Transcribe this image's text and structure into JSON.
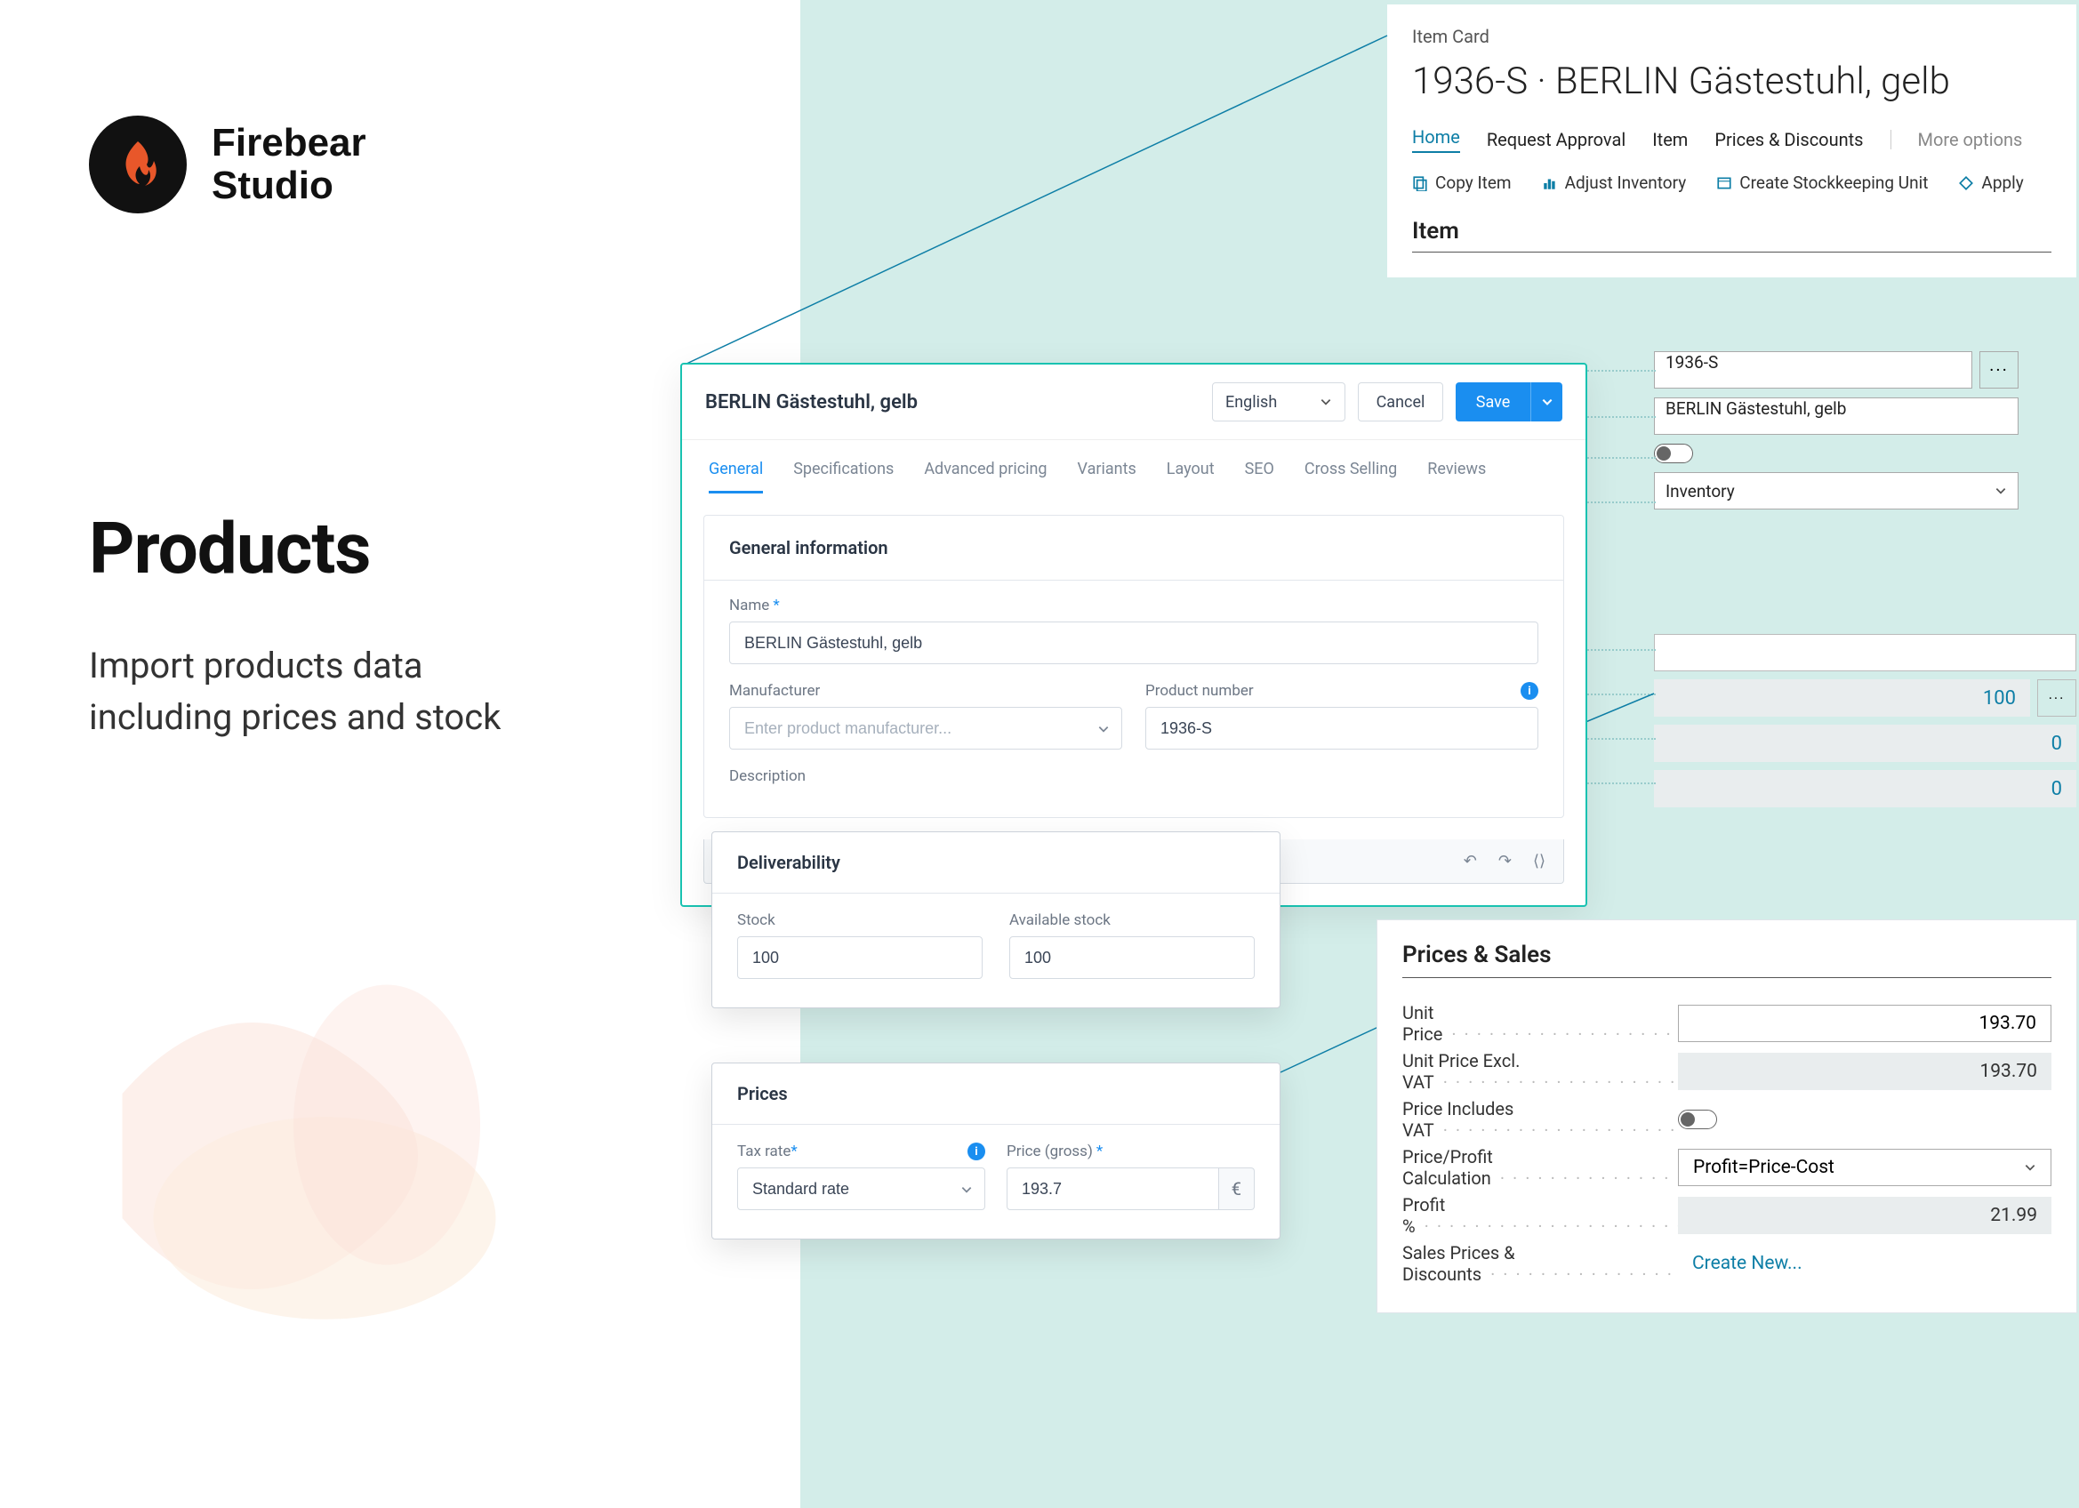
{
  "brand": {
    "line1": "Firebear",
    "line2": "Studio"
  },
  "hero": {
    "title": "Products",
    "sub_line1": "Import products data",
    "sub_line2": "including prices and stock"
  },
  "item_card": {
    "label": "Item Card",
    "title": "1936-S · BERLIN Gästestuhl, gelb",
    "tabs": [
      "Home",
      "Request Approval",
      "Item",
      "Prices & Discounts"
    ],
    "more": "More options",
    "actions": {
      "copy": "Copy Item",
      "adjust": "Adjust Inventory",
      "sku": "Create Stockkeeping Unit",
      "apply": "Apply"
    },
    "section": "Item",
    "number": "1936-S",
    "name": "BERLIN Gästestuhl, gelb",
    "inventory_label": "Inventory",
    "stock_value": "100",
    "zero1": "0",
    "zero2": "0"
  },
  "product": {
    "header_title": "BERLIN Gästestuhl, gelb",
    "language": "English",
    "cancel": "Cancel",
    "save": "Save",
    "tabs": [
      "General",
      "Specifications",
      "Advanced pricing",
      "Variants",
      "Layout",
      "SEO",
      "Cross Selling",
      "Reviews"
    ],
    "section_title": "General information",
    "name_label": "Name",
    "name_value": "BERLIN Gästestuhl, gelb",
    "manufacturer_label": "Manufacturer",
    "manufacturer_placeholder": "Enter product manufacturer...",
    "product_number_label": "Product number",
    "product_number_value": "1936-S",
    "description_label": "Description"
  },
  "deliver": {
    "title": "Deliverability",
    "stock_label": "Stock",
    "stock_value": "100",
    "available_label": "Available stock",
    "available_value": "100"
  },
  "prices": {
    "title": "Prices",
    "tax_label": "Tax rate",
    "tax_value": "Standard rate",
    "gross_label": "Price (gross)",
    "gross_value": "193.7",
    "currency": "€"
  },
  "ps": {
    "title": "Prices & Sales",
    "unit_price_label": "Unit Price",
    "unit_price_value": "193.70",
    "unit_excl_label": "Unit Price Excl. VAT",
    "unit_excl_value": "193.70",
    "vat_label": "Price Includes VAT",
    "calc_label": "Price/Profit Calculation",
    "calc_value": "Profit=Price-Cost",
    "profit_label": "Profit %",
    "profit_value": "21.99",
    "discounts_label": "Sales Prices & Discounts",
    "discounts_link": "Create New..."
  }
}
